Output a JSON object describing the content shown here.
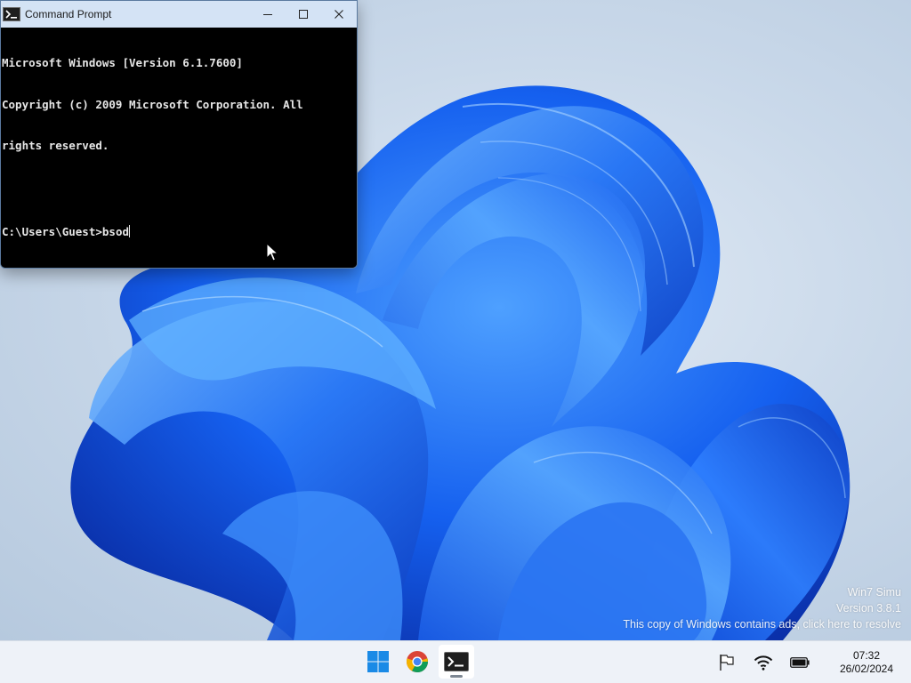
{
  "window": {
    "title": "Command Prompt",
    "title_icon": "console-icon",
    "controls": {
      "minimize": "minimize-icon",
      "maximize": "maximize-icon",
      "close": "close-icon"
    }
  },
  "console": {
    "lines": [
      "Microsoft Windows [Version 6.1.7600]",
      "Copyright (c) 2009 Microsoft Corporation. All",
      "rights reserved."
    ],
    "prompt": "C:\\Users\\Guest>",
    "input": "bsod"
  },
  "watermark": {
    "line1": "Win7 Simu",
    "line2": "Version 3.8.1",
    "line3": "This copy of Windows contains ads, click here to resolve"
  },
  "taskbar": {
    "apps": [
      {
        "name": "start-button",
        "icon": "windows-logo-icon",
        "active": false
      },
      {
        "name": "chrome-button",
        "icon": "chrome-icon",
        "active": false
      },
      {
        "name": "command-prompt-button",
        "icon": "console-icon",
        "active": true
      }
    ],
    "tray": {
      "icons": [
        "flag-icon",
        "wifi-icon",
        "battery-icon"
      ],
      "time": "07:32",
      "date": "26/02/2024"
    }
  },
  "colors": {
    "wallpaper_bloom": "#1f6bf0",
    "taskbar_bg": "#eef2f8",
    "titlebar_bg": "#d4e3f5",
    "console_bg": "#000000",
    "console_fg": "#e6e6e6"
  }
}
